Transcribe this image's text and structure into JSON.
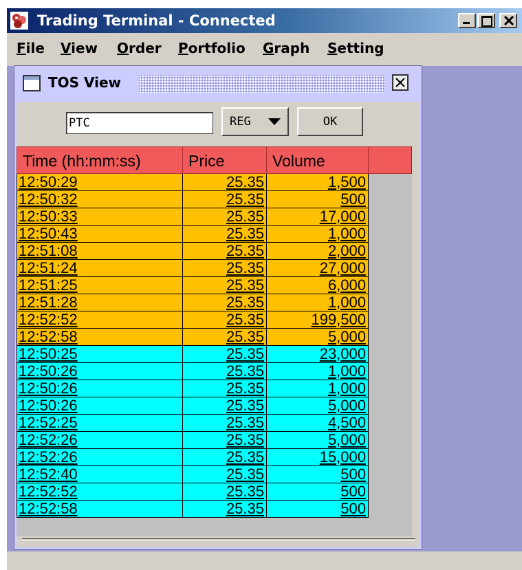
{
  "window": {
    "title": "Trading Terminal - Connected"
  },
  "menu": [
    "File",
    "View",
    "Order",
    "Portfolio",
    "Graph",
    "Setting"
  ],
  "tos_view": {
    "title": "TOS View",
    "symbol_value": "PTC",
    "market_select_value": "REG",
    "ok_label": "OK",
    "columns": [
      "Time (hh:mm:ss)",
      "Price",
      "Volume"
    ],
    "header_color": "#f05a5a",
    "row_colors": {
      "orange": "#ffc000",
      "cyan": "#00ffff"
    },
    "rows": [
      {
        "time": "12:50:29",
        "price": "25.35",
        "volume": "1,500",
        "color": "orange"
      },
      {
        "time": "12:50:32",
        "price": "25.35",
        "volume": "500",
        "color": "orange"
      },
      {
        "time": "12:50:33",
        "price": "25.35",
        "volume": "17,000",
        "color": "orange"
      },
      {
        "time": "12:50:43",
        "price": "25.35",
        "volume": "1,000",
        "color": "orange"
      },
      {
        "time": "12:51:08",
        "price": "25.35",
        "volume": "2,000",
        "color": "orange"
      },
      {
        "time": "12:51:24",
        "price": "25.35",
        "volume": "27,000",
        "color": "orange"
      },
      {
        "time": "12:51:25",
        "price": "25.35",
        "volume": "6,000",
        "color": "orange"
      },
      {
        "time": "12:51:28",
        "price": "25.35",
        "volume": "1,000",
        "color": "orange"
      },
      {
        "time": "12:52:52",
        "price": "25.35",
        "volume": "199,500",
        "color": "orange"
      },
      {
        "time": "12:52:58",
        "price": "25.35",
        "volume": "5,000",
        "color": "orange"
      },
      {
        "time": "12:50:25",
        "price": "25.35",
        "volume": "23,000",
        "color": "cyan"
      },
      {
        "time": "12:50:26",
        "price": "25.35",
        "volume": "1,000",
        "color": "cyan"
      },
      {
        "time": "12:50:26",
        "price": "25.35",
        "volume": "1,000",
        "color": "cyan"
      },
      {
        "time": "12:50:26",
        "price": "25.35",
        "volume": "5,000",
        "color": "cyan"
      },
      {
        "time": "12:52:25",
        "price": "25.35",
        "volume": "4,500",
        "color": "cyan"
      },
      {
        "time": "12:52:26",
        "price": "25.35",
        "volume": "5,000",
        "color": "cyan"
      },
      {
        "time": "12:52:26",
        "price": "25.35",
        "volume": "15,000",
        "color": "cyan"
      },
      {
        "time": "12:52:40",
        "price": "25.35",
        "volume": "500",
        "color": "cyan"
      },
      {
        "time": "12:52:52",
        "price": "25.35",
        "volume": "500",
        "color": "cyan"
      },
      {
        "time": "12:52:58",
        "price": "25.35",
        "volume": "500",
        "color": "cyan"
      }
    ]
  }
}
